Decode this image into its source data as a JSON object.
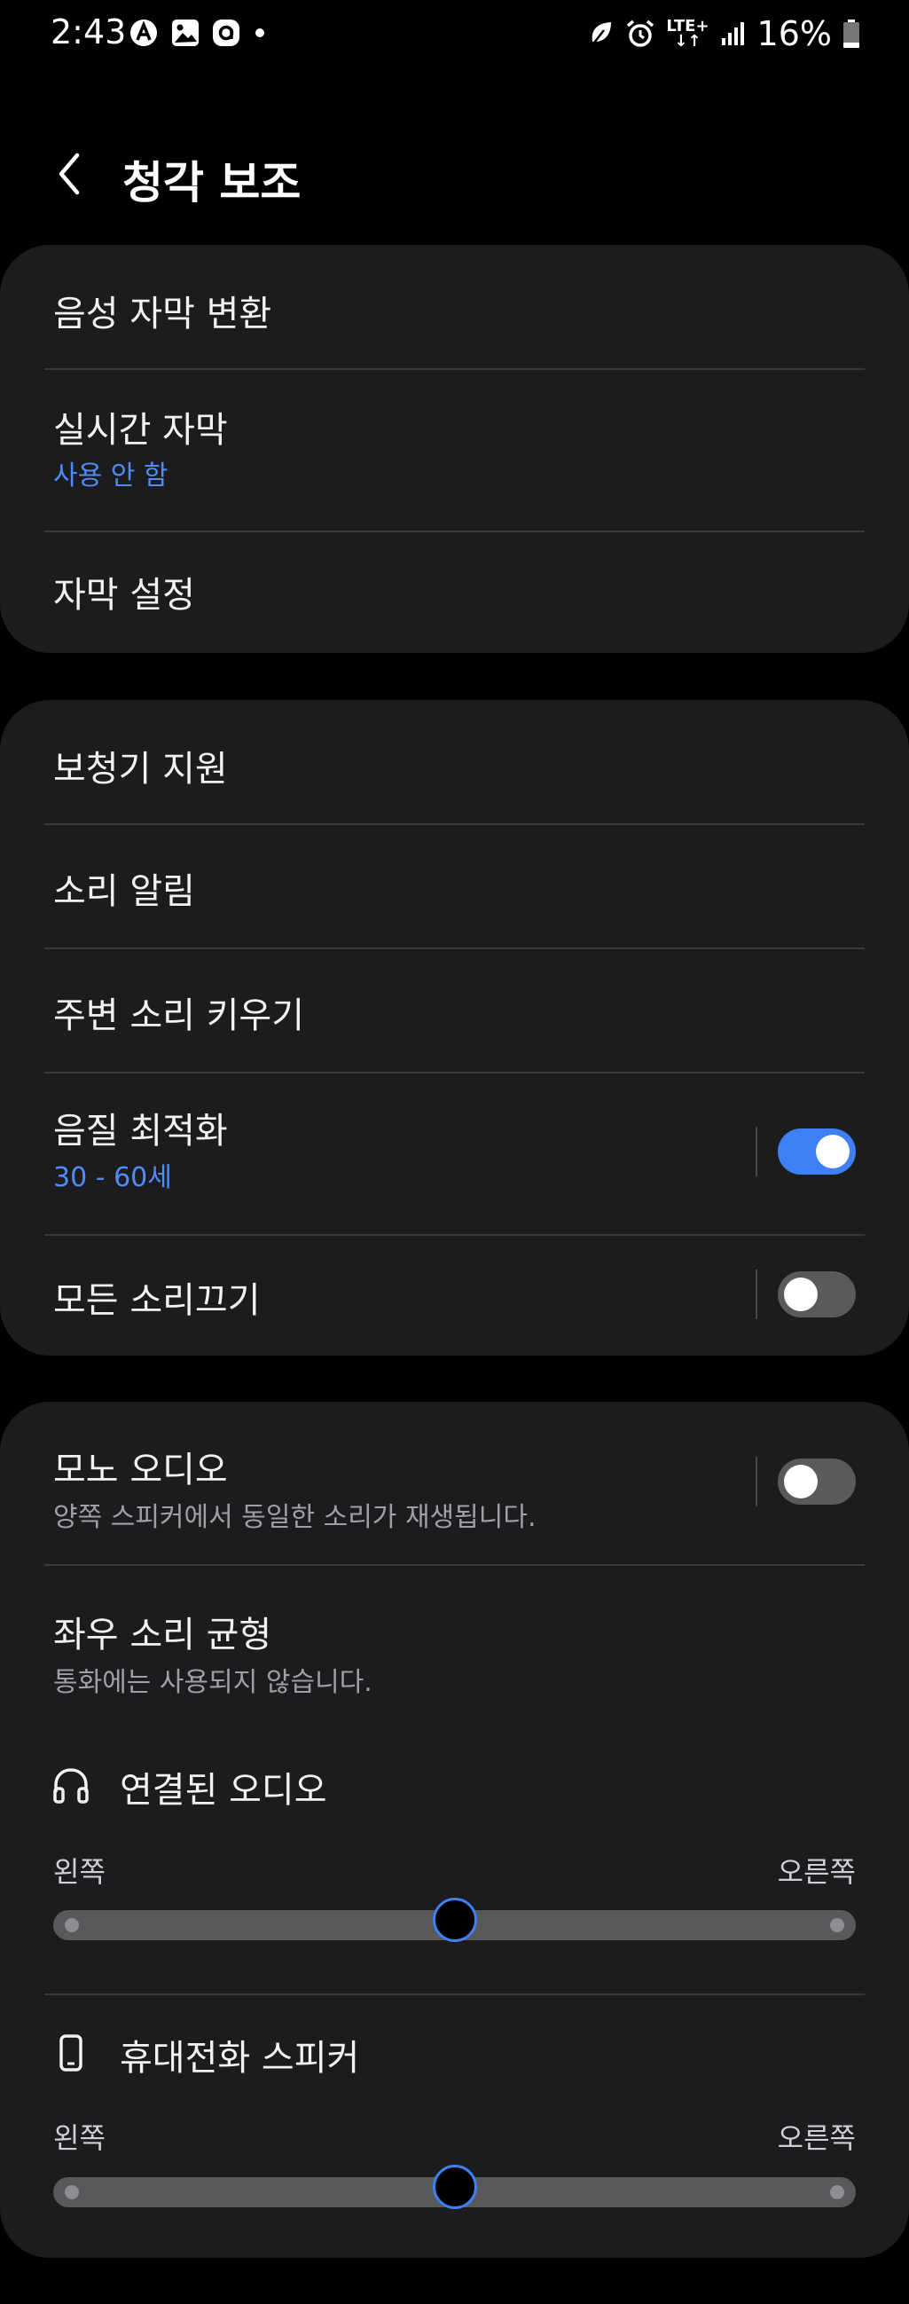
{
  "status_bar": {
    "time": "2:43",
    "network": "LTE+",
    "battery": "16%",
    "icons": [
      "auto-sync-icon",
      "gallery-icon",
      "assistant-icon",
      "notification-dot-icon",
      "leaf-icon",
      "alarm-icon",
      "lte-icon",
      "signal-icon",
      "battery-icon"
    ]
  },
  "header": {
    "title": "청각 보조"
  },
  "card1": {
    "items": [
      {
        "title": "음성 자막 변환"
      },
      {
        "title": "실시간 자막",
        "subtitle": "사용 안 함"
      },
      {
        "title": "자막 설정"
      }
    ]
  },
  "card2": {
    "items": [
      {
        "title": "보청기 지원"
      },
      {
        "title": "소리 알림"
      },
      {
        "title": "주변 소리 키우기"
      },
      {
        "title": "음질 최적화",
        "subtitle": "30 - 60세",
        "toggle_on": true
      },
      {
        "title": "모든 소리끄기",
        "toggle_on": false
      }
    ]
  },
  "card3": {
    "mono": {
      "title": "모노 오디오",
      "description": "양쪽 스피커에서 동일한 소리가 재생됩니다.",
      "toggle_on": false
    },
    "balance": {
      "title": "좌우 소리 균형",
      "description": "통화에는 사용되지 않습니다."
    },
    "connected_audio": {
      "heading": "연결된 오디오",
      "icon": "headphones-icon",
      "left_label": "왼쪽",
      "right_label": "오른쪽",
      "balance_value": 0.5
    },
    "phone_speaker": {
      "heading": "휴대전화 스피커",
      "icon": "phone-icon",
      "left_label": "왼쪽",
      "right_label": "오른쪽",
      "balance_value": 0.5
    }
  },
  "colors": {
    "background": "#000000",
    "card": "#1c1c1e",
    "accent": "#3e80f5",
    "subtitle_blue": "#4e8cf7"
  }
}
